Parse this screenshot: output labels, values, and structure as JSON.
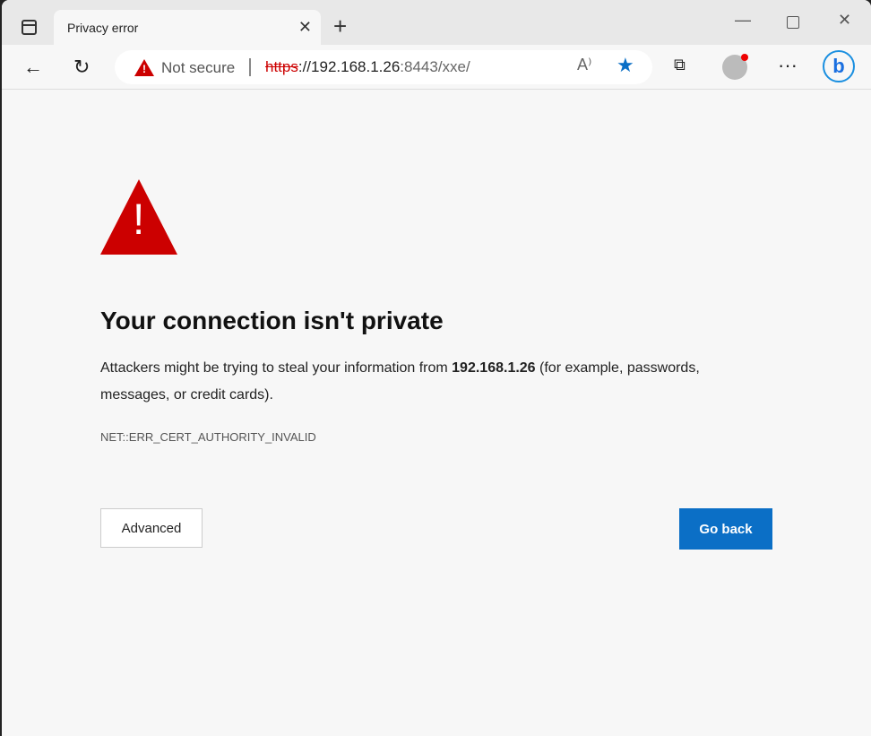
{
  "tab": {
    "title": "Privacy error"
  },
  "address": {
    "security": "Not secure",
    "scheme": "https",
    "host": "://192.168.1.26",
    "port": ":8443/xxe/"
  },
  "page": {
    "title": "Your connection isn't private",
    "msg_pre": "Attackers might be trying to steal your information from ",
    "host": "192.168.1.26",
    "msg_post": " (for example, passwords, messages, or credit cards).",
    "error_code": "NET::ERR_CERT_AUTHORITY_INVALID",
    "advanced": "Advanced",
    "go_back": "Go back"
  },
  "colors": {
    "accent": "#0b6fc6",
    "danger": "#cc0000"
  }
}
